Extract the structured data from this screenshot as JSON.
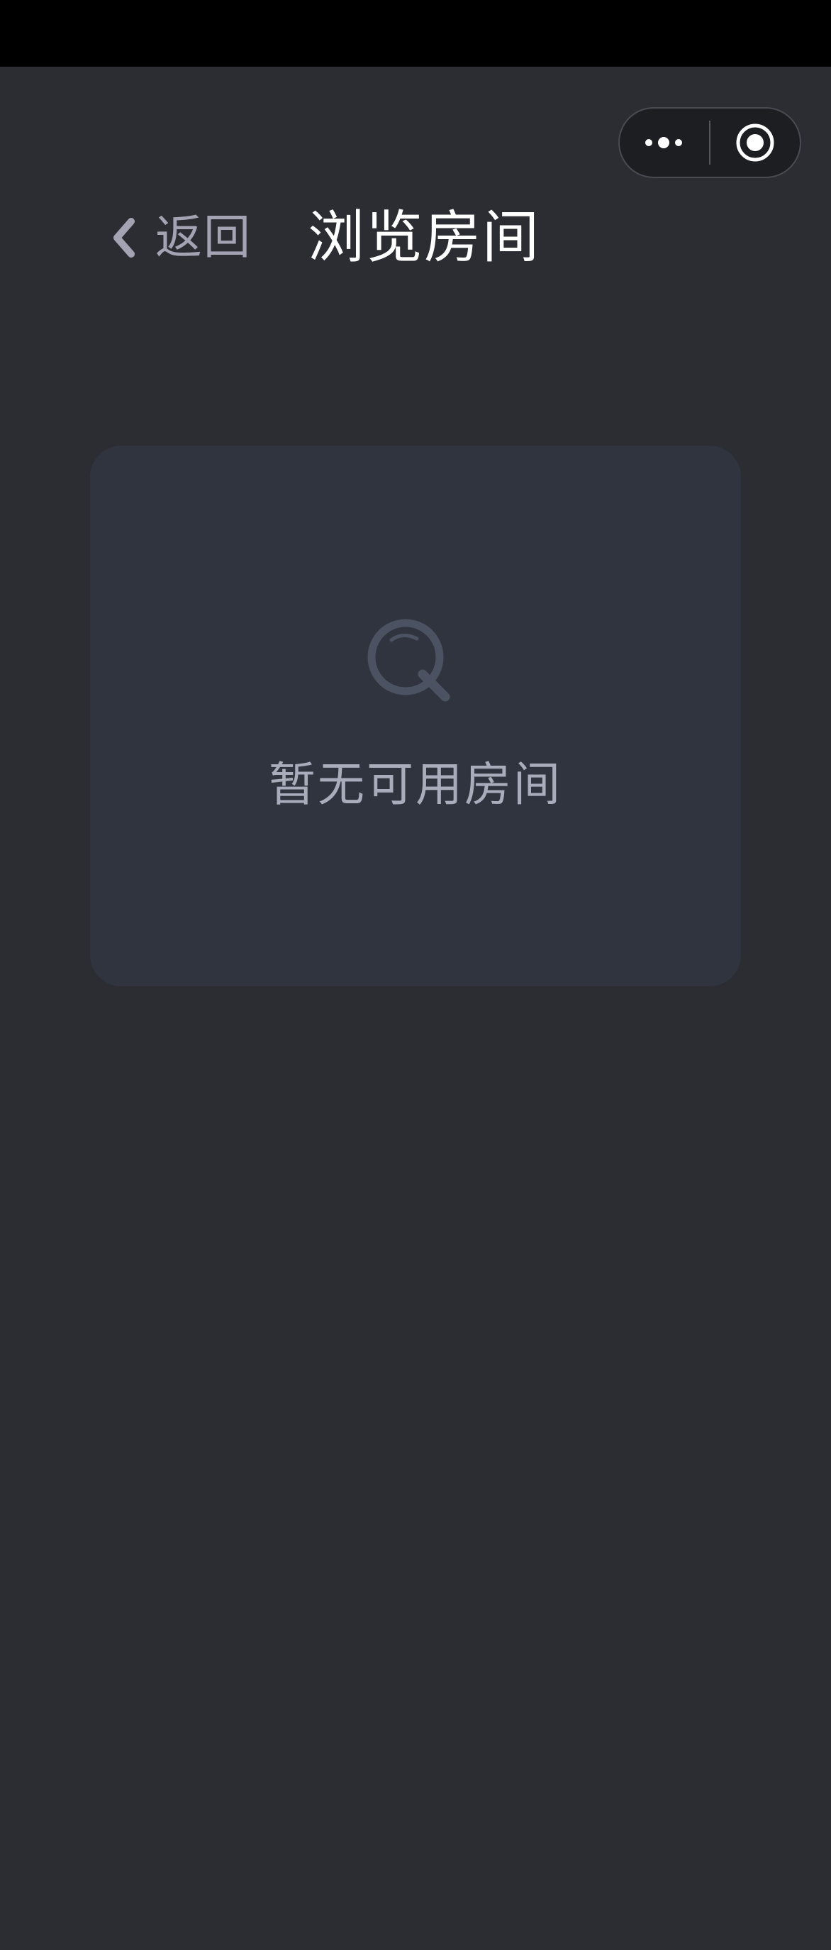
{
  "header": {
    "back_label": "返回",
    "title": "浏览房间"
  },
  "empty_state": {
    "message": "暂无可用房间",
    "icon": "search-icon"
  },
  "capsule": {
    "more_icon": "more-dots-icon",
    "close_icon": "target-circle-icon"
  },
  "colors": {
    "background": "#2c2d33",
    "card": "#30343e",
    "title": "#ffffff",
    "muted_text": "#a3a3b3",
    "icon_muted": "#4b5262"
  }
}
